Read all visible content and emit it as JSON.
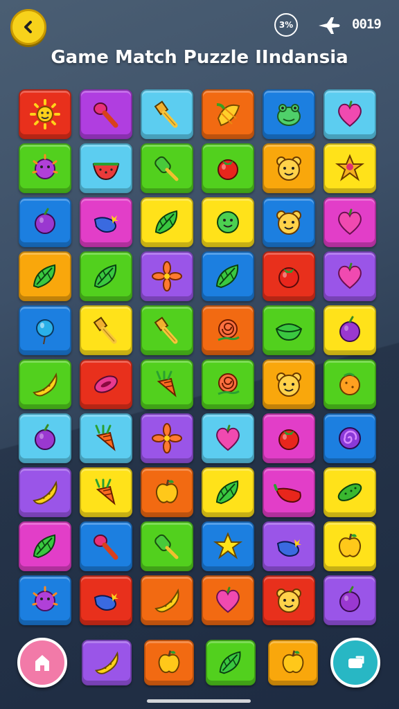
{
  "header": {
    "title": "Game Match Puzzle IIndansia",
    "progress_text": "3%",
    "score_text": "0019"
  },
  "icons": {
    "back": "chevron-left-icon",
    "progress": "progress-ring-icon",
    "plane": "plane-icon",
    "home": "home-icon",
    "shuffle": "shuffle-icon"
  },
  "colors": {
    "red": "#e8301c",
    "purple": "#b03ee0",
    "cyan": "#5ccdf0",
    "orange": "#f26a12",
    "blue": "#1c7fe0",
    "green": "#52d01e",
    "yellow": "#ffe21a",
    "amber": "#f9a70c",
    "magenta": "#e23ec8",
    "violet": "#9a55e8",
    "accent_yellow": "#f7d21b"
  },
  "board": {
    "rows": 10,
    "cols": 6,
    "tiles": [
      [
        "red:sun",
        "purple:spoon",
        "cyan:brush",
        "orange:corn",
        "blue:frog",
        "cyan:heart"
      ],
      [
        "green:ball",
        "cyan:melon",
        "green:popsicle",
        "green:tomato",
        "amber:bear",
        "yellow:star-fruit"
      ],
      [
        "blue:plum",
        "magenta:eggplant",
        "yellow:leaf",
        "yellow:face",
        "blue:bear",
        "magenta:heart"
      ],
      [
        "amber:leaf",
        "green:leaf",
        "violet:flower",
        "blue:leaf",
        "red:tomato",
        "violet:heart"
      ],
      [
        "blue:balloon",
        "yellow:brush",
        "green:brush",
        "orange:rose",
        "green:bowl",
        "yellow:plum"
      ],
      [
        "green:banana",
        "red:bean",
        "green:carrot",
        "green:rose",
        "amber:bear",
        "green:orange"
      ],
      [
        "cyan:plum",
        "cyan:carrot",
        "violet:flower",
        "cyan:heart",
        "magenta:tomato",
        "blue:spiral"
      ],
      [
        "violet:banana",
        "yellow:carrot",
        "orange:apple",
        "yellow:leaf",
        "magenta:pepper",
        "yellow:cucumber"
      ],
      [
        "magenta:leaf",
        "blue:spoon",
        "green:popsicle",
        "blue:star",
        "violet:eggplant",
        "yellow:apple"
      ],
      [
        "blue:ball",
        "red:eggplant",
        "orange:banana",
        "orange:heart",
        "red:bear",
        "violet:plum"
      ]
    ]
  },
  "dock": {
    "left_button": "home-icon",
    "right_button": "shuffle-icon",
    "tiles": [
      "violet:banana",
      "orange:apple",
      "green:leaf",
      "amber:apple"
    ]
  }
}
